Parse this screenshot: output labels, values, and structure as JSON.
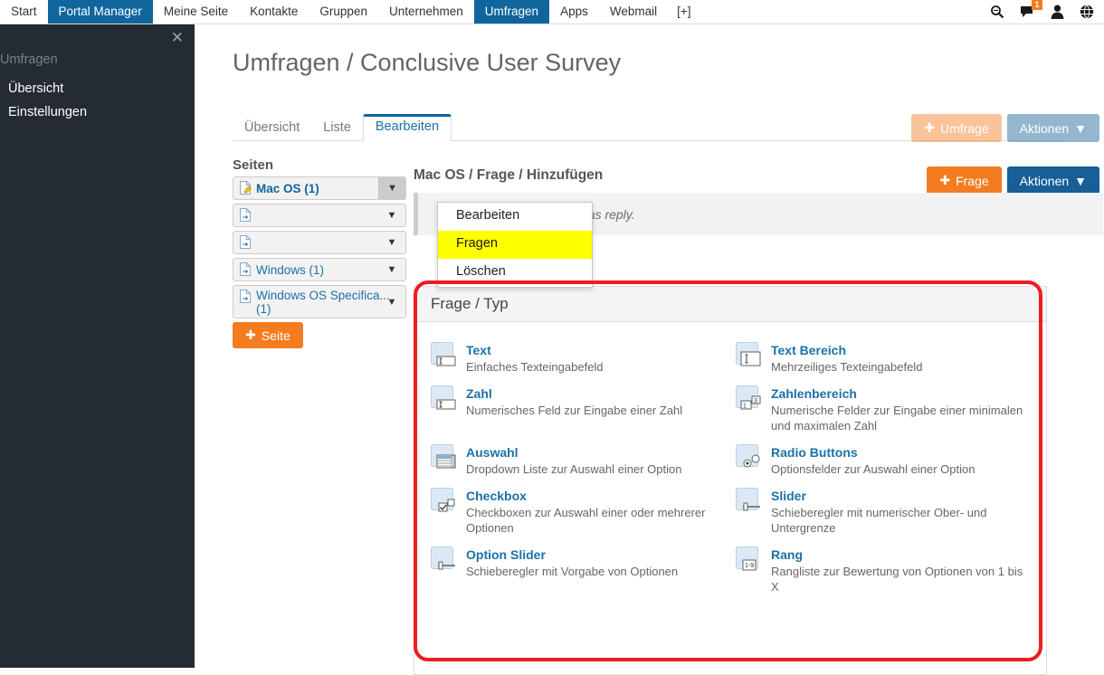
{
  "topnav": {
    "items": [
      {
        "label": "Start",
        "active": false
      },
      {
        "label": "Portal Manager",
        "active": true
      },
      {
        "label": "Meine Seite",
        "active": false
      },
      {
        "label": "Kontakte",
        "active": false
      },
      {
        "label": "Gruppen",
        "active": false
      },
      {
        "label": "Unternehmen",
        "active": false
      },
      {
        "label": "Umfragen",
        "active": true
      },
      {
        "label": "Apps",
        "active": false
      },
      {
        "label": "Webmail",
        "active": false
      },
      {
        "label": "[+]",
        "active": false
      }
    ],
    "icons": [
      {
        "name": "search-icon"
      },
      {
        "name": "chat-icon",
        "badge": "1"
      },
      {
        "name": "user-icon"
      },
      {
        "name": "globe-icon"
      }
    ],
    "active_color": "#10659c",
    "badge_color": "#f47c20"
  },
  "sidebar": {
    "close_label": "✕",
    "heading": "Umfragen",
    "items": [
      {
        "label": "Übersicht"
      },
      {
        "label": "Einstellungen"
      }
    ],
    "background": "#252b33"
  },
  "page": {
    "title": "Umfragen / Conclusive User Survey"
  },
  "tabs": [
    {
      "label": "Übersicht",
      "active": false
    },
    {
      "label": "Liste",
      "active": false
    },
    {
      "label": "Bearbeiten",
      "active": true
    }
  ],
  "top_buttons": {
    "survey": {
      "label": "Umfrage",
      "icon": "plus-icon",
      "color": "#f47c20",
      "disabled": true
    },
    "actions": {
      "label": "Aktionen",
      "icon": "chevron-down-icon",
      "color": "#175f96",
      "disabled": true
    }
  },
  "pages_panel": {
    "title": "Seiten",
    "items": [
      {
        "label": "Mac OS (1)",
        "selected": true,
        "icon": "document-edit-icon"
      },
      {
        "label": "",
        "selected": false,
        "icon": "document-icon"
      },
      {
        "label": "",
        "selected": false,
        "icon": "document-icon"
      },
      {
        "label": "Windows (1)",
        "selected": false,
        "icon": "document-icon"
      },
      {
        "label": "Windows OS Specifica... (1)",
        "selected": false,
        "icon": "document-icon"
      }
    ],
    "add_button": {
      "label": "Seite",
      "icon": "plus-icon",
      "color": "#f47c20"
    }
  },
  "dropdown": {
    "items": [
      {
        "label": "Bearbeiten",
        "highlighted": false
      },
      {
        "label": "Fragen",
        "highlighted": true
      },
      {
        "label": "Löschen",
        "highlighted": false
      }
    ],
    "highlight_color": "#ffff00"
  },
  "content": {
    "breadcrumb": "Mac OS / Frage / Hinzufügen",
    "info_message": "You have chosen Mac OS as reply.",
    "buttons": {
      "add_question": {
        "label": "Frage",
        "icon": "plus-icon",
        "color": "#f47c20"
      },
      "actions": {
        "label": "Aktionen",
        "icon": "chevron-down-icon",
        "color": "#175f96"
      }
    }
  },
  "question_types_panel": {
    "header": "Frage / Typ",
    "annotation_color": "#ee1c22",
    "types": [
      {
        "title": "Text",
        "desc": "Einfaches Texteingabefeld",
        "icon": "text-field-icon"
      },
      {
        "title": "Text Bereich",
        "desc": "Mehrzeiliges Texteingabefeld",
        "icon": "textarea-icon"
      },
      {
        "title": "Zahl",
        "desc": "Numerisches Feld zur Eingabe einer Zahl",
        "icon": "number-field-icon"
      },
      {
        "title": "Zahlenbereich",
        "desc": "Numerische Felder zur Eingabe einer minimalen und maximalen Zahl",
        "icon": "number-range-icon"
      },
      {
        "title": "Auswahl",
        "desc": "Dropdown Liste zur Auswahl einer Option",
        "icon": "dropdown-icon"
      },
      {
        "title": "Radio Buttons",
        "desc": "Optionsfelder zur Auswahl einer Option",
        "icon": "radio-button-icon"
      },
      {
        "title": "Checkbox",
        "desc": "Checkboxen zur Auswahl einer oder mehrerer Optionen",
        "icon": "checkbox-icon"
      },
      {
        "title": "Slider",
        "desc": "Schieberegler mit numerischer Ober- und Untergrenze",
        "icon": "slider-icon"
      },
      {
        "title": "Option Slider",
        "desc": "Schieberegler mit Vorgabe von Optionen",
        "icon": "option-slider-icon"
      },
      {
        "title": "Rang",
        "desc": "Rangliste zur Bewertung von Optionen von 1 bis X",
        "icon": "ranking-icon"
      }
    ]
  }
}
